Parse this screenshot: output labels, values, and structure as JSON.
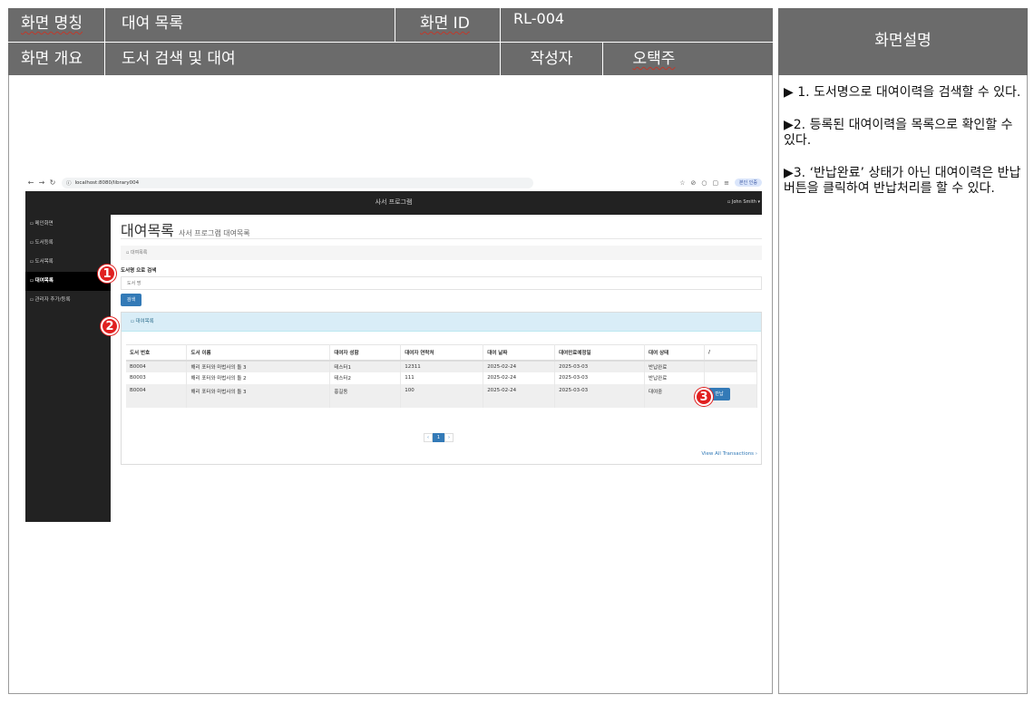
{
  "spec": {
    "screen_name_label": "화면 명칭",
    "screen_name_value": "대여 목록",
    "screen_id_label": "화면 ID",
    "screen_id_value": "RL-004",
    "overview_label": "화면 개요",
    "overview_value": "도서 검색 및 대여",
    "author_label": "작성자",
    "author_value": "오택주"
  },
  "description": {
    "title": "화면설명",
    "items": [
      "▶  1. 도서명으로 대여이력을 검색할 수 있다.",
      "▶2. 등록된 대여이력을 목록으로 확인할 수 있다.",
      "▶3. ‘반납완료’ 상태가 아닌 대여이력은 반납 버튼을 클릭하여 반납처리를 할 수 있다."
    ]
  },
  "browser": {
    "url": "localhost:8080/library004",
    "profile": "본인 인증"
  },
  "app": {
    "title": "사서 프로그램",
    "user": "John Smith",
    "sidebar": [
      {
        "label": "메인화면"
      },
      {
        "label": "도서등록"
      },
      {
        "label": "도서목록"
      },
      {
        "label": "대여목록",
        "active": true
      },
      {
        "label": "관리자 추가/등록"
      }
    ],
    "page_title": "대여목록",
    "page_subtitle": "사서 프로그램 대여목록",
    "breadcrumb": "대여목록",
    "search_label": "도서명 으로 검색",
    "search_placeholder": "도서 명",
    "search_button": "검색",
    "panel_title": "대여목록",
    "table": {
      "headers": [
        "도서 번호",
        "도서 이름",
        "대여자 성함",
        "대여자 연락처",
        "대여 날짜",
        "대여만료예정일",
        "대여 상태",
        "/"
      ],
      "rows": [
        [
          "B0004",
          "해리 포터와 마법사의 돌 3",
          "테스터1",
          "12311",
          "2025-02-24",
          "2025-03-03",
          "반납완료",
          ""
        ],
        [
          "B0003",
          "해리 포터와 마법사의 돌 2",
          "테스터2",
          "111",
          "2025-02-24",
          "2025-03-03",
          "반납완료",
          ""
        ],
        [
          "B0004",
          "해리 포터와 마법사의 돌 3",
          "홍길동",
          "100",
          "2025-02-24",
          "2025-03-03",
          "대여중",
          "반납"
        ]
      ]
    },
    "pagination": {
      "prev": "‹",
      "current": "1",
      "next": "›"
    },
    "view_all": "View All Transactions"
  },
  "annotations": [
    "1",
    "2",
    "3"
  ],
  "colors": {
    "header_gray": "#6b6b6b",
    "app_dark": "#222222",
    "primary": "#337ab7",
    "panel_head": "#d9edf7",
    "badge_red": "#e02020"
  }
}
